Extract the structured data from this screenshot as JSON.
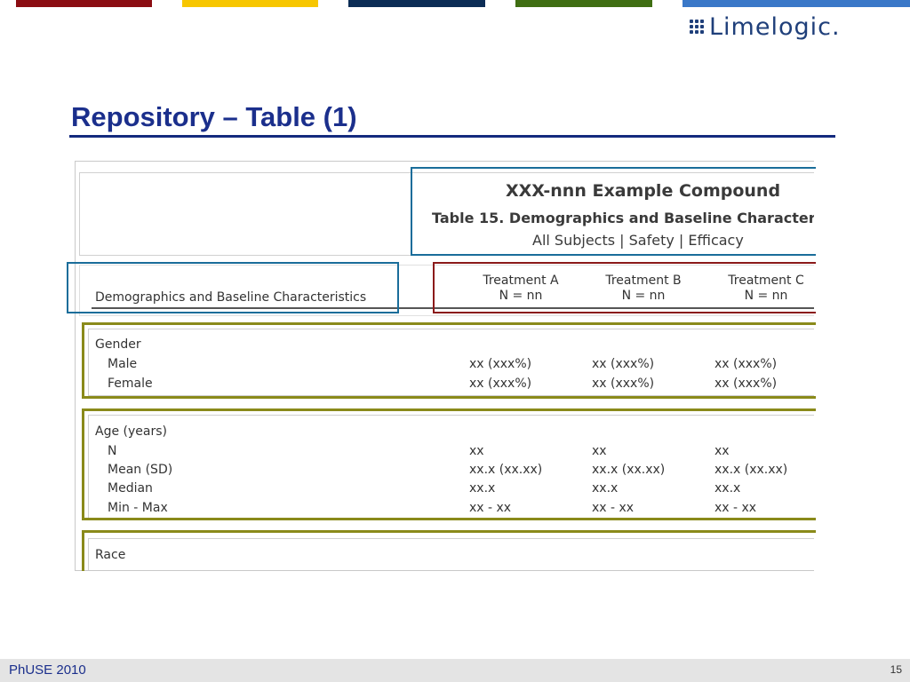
{
  "colors": {
    "bar1": "#8b0d12",
    "bar2": "#f7c600",
    "bar3": "#0b2c55",
    "bar4": "#3f6e12",
    "title": "#1b2f8c",
    "box_blue": "#1a6d9a",
    "box_red": "#8b1a1a",
    "box_olive": "#8a8a1a"
  },
  "logo": {
    "text": "Limelogic",
    "dot": "."
  },
  "slide": {
    "title": "Repository – Table (1)"
  },
  "table": {
    "compound": "XXX-nnn Example Compound",
    "title": "Table 15. Demographics and Baseline Character",
    "subsets": "All Subjects | Safety | Efficacy",
    "row_header": "Demographics and Baseline Characteristics",
    "columns": [
      {
        "name": "Treatment A",
        "n": "N = nn"
      },
      {
        "name": "Treatment B",
        "n": "N = nn"
      },
      {
        "name": "Treatment C",
        "n": "N = nn"
      }
    ],
    "groups": [
      {
        "name": "Gender",
        "rows": [
          {
            "label": "Male",
            "values": [
              "xx (xxx%)",
              "xx (xxx%)",
              "xx (xxx%)"
            ]
          },
          {
            "label": "Female",
            "values": [
              "xx (xxx%)",
              "xx (xxx%)",
              "xx (xxx%)"
            ]
          }
        ]
      },
      {
        "name": "Age (years)",
        "rows": [
          {
            "label": "N",
            "values": [
              "xx",
              "xx",
              "xx"
            ]
          },
          {
            "label": "Mean (SD)",
            "values": [
              "xx.x (xx.xx)",
              "xx.x (xx.xx)",
              "xx.x (xx.xx)"
            ]
          },
          {
            "label": "Median",
            "values": [
              "xx.x",
              "xx.x",
              "xx.x"
            ]
          },
          {
            "label": "Min - Max",
            "values": [
              "xx - xx",
              "xx - xx",
              "xx - xx"
            ]
          }
        ]
      },
      {
        "name": "Race",
        "rows": []
      }
    ]
  },
  "footer": {
    "left": "PhUSE 2010",
    "page": "15"
  }
}
